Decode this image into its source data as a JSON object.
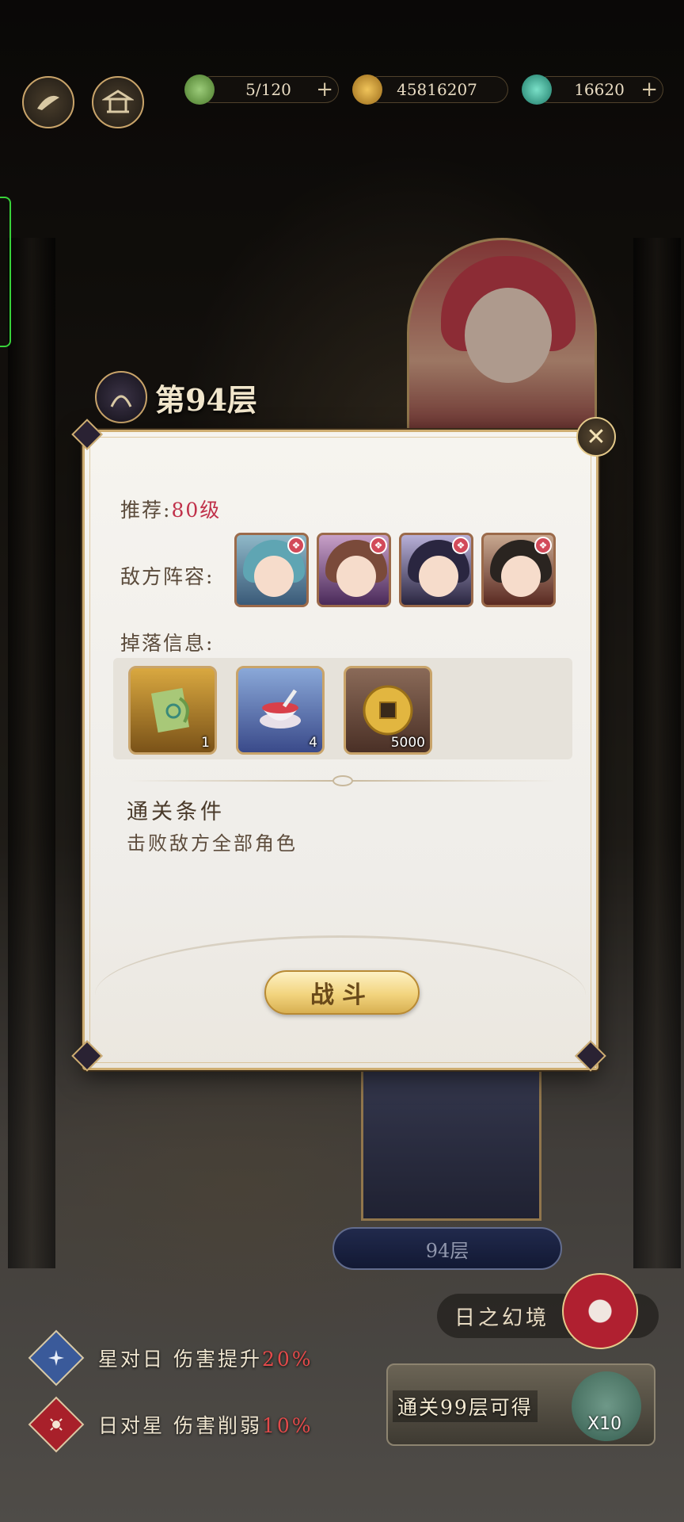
{
  "topbar": {
    "stamina": "5/120",
    "coins": "45816207",
    "jade": "16620",
    "plus": "+"
  },
  "floor": {
    "title": "第94层",
    "badge": "94层"
  },
  "dialog": {
    "close_symbol": "✕",
    "recommend_label": "推荐:",
    "recommend_level": "80级",
    "enemy_label": "敌方阵容:",
    "drop_label": "掉落信息:",
    "enemies": [
      {
        "hair": "#5fa5b3"
      },
      {
        "hair": "#7a4a3a"
      },
      {
        "hair": "#2a2640"
      },
      {
        "hair": "#2a2420"
      }
    ],
    "drops": [
      {
        "icon": "scroll-icon",
        "count": "1"
      },
      {
        "icon": "bowl-icon",
        "count": "4"
      },
      {
        "icon": "coin-icon",
        "count": "5000"
      }
    ],
    "clear_title": "通关条件",
    "clear_text": "击败敌方全部角色",
    "fight_label": "战斗"
  },
  "realm": {
    "label": "日之幻境"
  },
  "buffs": [
    {
      "text": "星对日  伤害提升",
      "pct": "20%",
      "color": "#3a5a9a"
    },
    {
      "text": "日对星  伤害削弱",
      "pct": "10%",
      "color": "#a8202a"
    }
  ],
  "reward": {
    "label": "通关99层可得",
    "count": "X10"
  },
  "colors": {
    "gold": "#c9a46a",
    "red_text": "#c0314a",
    "pct_red": "#e34a4a"
  }
}
